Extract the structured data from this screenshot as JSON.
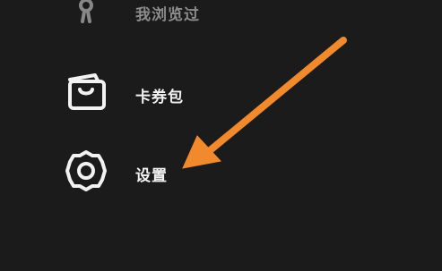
{
  "menu": {
    "items": [
      {
        "label": "我浏览过",
        "icon": "footprint-icon"
      },
      {
        "label": "卡券包",
        "icon": "wallet-icon"
      },
      {
        "label": "设置",
        "icon": "gear-icon"
      }
    ]
  },
  "annotation": {
    "arrow_color": "#f08a2c"
  }
}
